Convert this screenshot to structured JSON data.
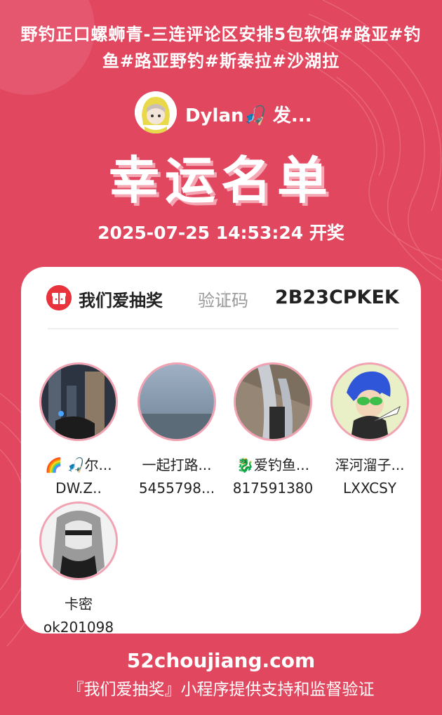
{
  "header": {
    "title": "野钓正口螺蛳青-三连评论区安排5包软饵#路亚#钓鱼#路亚野钓#斯泰拉#沙湖拉",
    "sender_name": "Dylan🎣 发...",
    "headline": "幸运名单",
    "draw_time": "2025-07-25 14:53:24 开奖"
  },
  "card": {
    "brand": "我们爱抽奖",
    "code_label": "验证码",
    "code_value": "2B23CPKEK",
    "winners": [
      {
        "nick": "🌈 🎣尔...",
        "uid": "DW.Z.."
      },
      {
        "nick": "一起打路...",
        "uid": "5455798..."
      },
      {
        "nick": "🐉爱钓鱼...",
        "uid": "817591380"
      },
      {
        "nick": "浑河溜子...",
        "uid": "LXXCSY"
      },
      {
        "nick": "卡密",
        "uid": "ok201098"
      }
    ]
  },
  "footer": {
    "site": "52choujiang.com",
    "note": "『我们爱抽奖』小程序提供支持和监督验证"
  },
  "colors": {
    "background": "#e1485f",
    "accent": "#e8323c",
    "ring": "#f2a3b3"
  }
}
